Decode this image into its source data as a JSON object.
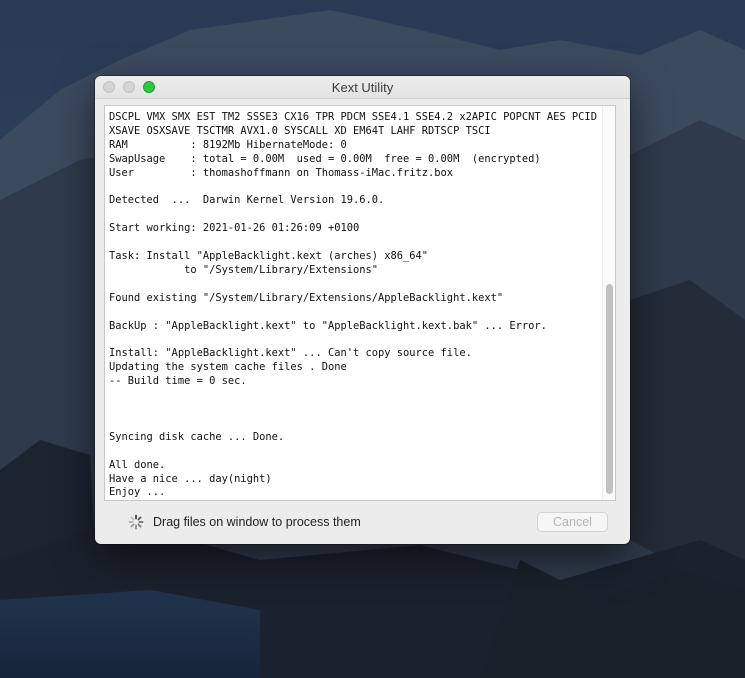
{
  "window": {
    "title": "Kext Utility",
    "status": "Drag files on window to process them",
    "cancel_label": "Cancel"
  },
  "log": {
    "lines": [
      "DSCPL VMX SMX EST TM2 SSSE3 CX16 TPR PDCM SSE4.1 SSE4.2 x2APIC POPCNT AES PCID",
      "XSAVE OSXSAVE TSCTMR AVX1.0 SYSCALL XD EM64T LAHF RDTSCP TSCI",
      "RAM          : 8192Mb HibernateMode: 0",
      "SwapUsage    : total = 0.00M  used = 0.00M  free = 0.00M  (encrypted)",
      "User         : thomashoffmann on Thomass-iMac.fritz.box",
      "",
      "Detected  ...  Darwin Kernel Version 19.6.0.",
      "",
      "Start working: 2021-01-26 01:26:09 +0100",
      "",
      "Task: Install \"AppleBacklight.kext (arches) x86_64\"",
      "            to \"/System/Library/Extensions\"",
      "",
      "Found existing \"/System/Library/Extensions/AppleBacklight.kext\"",
      "",
      "BackUp : \"AppleBacklight.kext\" to \"AppleBacklight.kext.bak\" ... Error.",
      "",
      "Install: \"AppleBacklight.kext\" ... Can't copy source file.",
      "Updating the system cache files . Done",
      "-- Build time = 0 sec.",
      "",
      "",
      "",
      "Syncing disk cache ... Done.",
      "",
      "All done.",
      "Have a nice ... day(night)",
      "Enjoy ..."
    ],
    "text": "DSCPL VMX SMX EST TM2 SSSE3 CX16 TPR PDCM SSE4.1 SSE4.2 x2APIC POPCNT AES PCID\nXSAVE OSXSAVE TSCTMR AVX1.0 SYSCALL XD EM64T LAHF RDTSCP TSCI\nRAM          : 8192Mb HibernateMode: 0\nSwapUsage    : total = 0.00M  used = 0.00M  free = 0.00M  (encrypted)\nUser         : thomashoffmann on Thomass-iMac.fritz.box\n\nDetected  ...  Darwin Kernel Version 19.6.0.\n\nStart working: 2021-01-26 01:26:09 +0100\n\nTask: Install \"AppleBacklight.kext (arches) x86_64\"\n            to \"/System/Library/Extensions\"\n\nFound existing \"/System/Library/Extensions/AppleBacklight.kext\"\n\nBackUp : \"AppleBacklight.kext\" to \"AppleBacklight.kext.bak\" ... Error.\n\nInstall: \"AppleBacklight.kext\" ... Can't copy source file.\nUpdating the system cache files . Done\n-- Build time = 0 sec.\n\n\n\nSyncing disk cache ... Done.\n\nAll done.\nHave a nice ... day(night)\nEnjoy ..."
  },
  "icons": {
    "close": "close-icon",
    "minimize": "minimize-icon",
    "zoom": "zoom-icon",
    "spinner": "spinner-icon"
  },
  "colors": {
    "zoom_button": "#2bc840",
    "disabled_text": "#b4b4b4",
    "desktop_sky": "#2d3d57"
  }
}
